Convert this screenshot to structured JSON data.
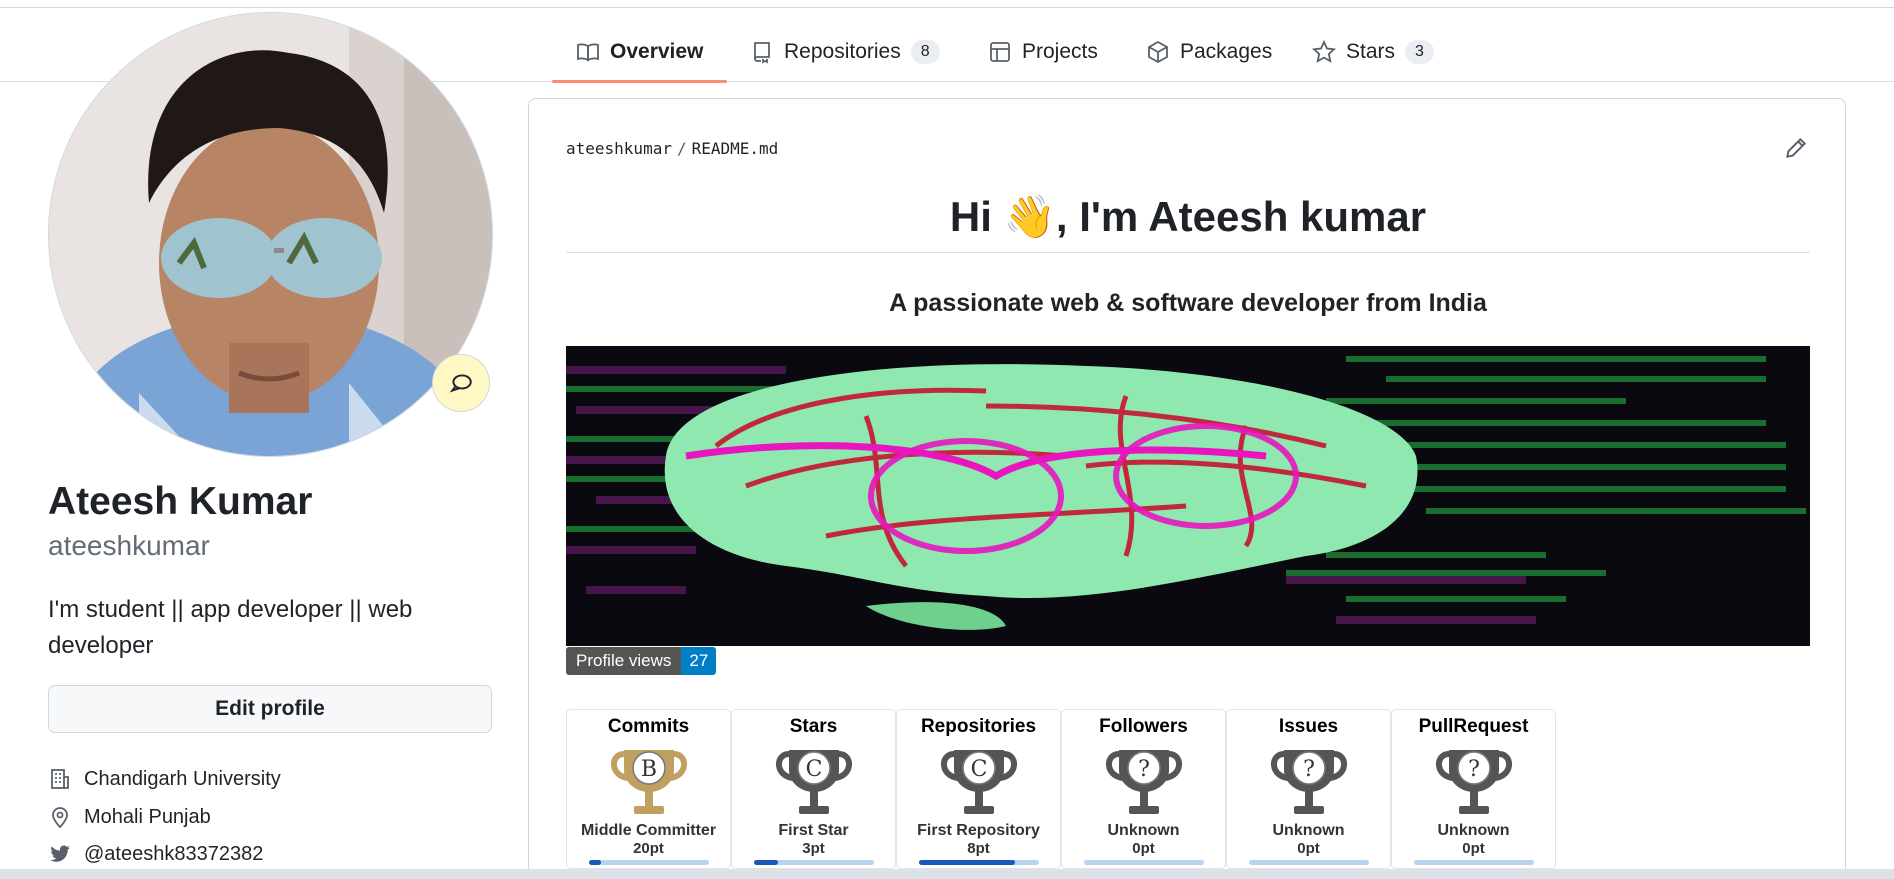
{
  "tabs": [
    {
      "label": "Overview",
      "icon": "book-icon",
      "active": true
    },
    {
      "label": "Repositories",
      "icon": "repo-icon",
      "count": "8"
    },
    {
      "label": "Projects",
      "icon": "table-icon"
    },
    {
      "label": "Packages",
      "icon": "package-icon"
    },
    {
      "label": "Stars",
      "icon": "star-icon",
      "count": "3"
    }
  ],
  "profile": {
    "fullname": "Ateesh Kumar",
    "username": "ateeshkumar",
    "bio": "I'm student || app developer || web developer",
    "edit_label": "Edit profile",
    "organization": "Chandigarh University",
    "location": "Mohali Punjab",
    "twitter": "@ateeshk83372382"
  },
  "readme": {
    "owner": "ateeshkumar",
    "file": "README.md",
    "title": "Hi 👋, I'm Ateesh kumar",
    "subtitle": "A passionate web & software developer from India",
    "badge_label": "Profile views",
    "badge_value": "27"
  },
  "trophies": [
    {
      "title": "Commits",
      "rank_letter": "B",
      "rank": "Middle Committer",
      "points": "20pt",
      "progress": 0.1,
      "color": "#c0a060"
    },
    {
      "title": "Stars",
      "rank_letter": "C",
      "rank": "First Star",
      "points": "3pt",
      "progress": 0.2,
      "color": "#555555"
    },
    {
      "title": "Repositories",
      "rank_letter": "C",
      "rank": "First Repository",
      "points": "8pt",
      "progress": 0.8,
      "color": "#555555"
    },
    {
      "title": "Followers",
      "rank_letter": "?",
      "rank": "Unknown",
      "points": "0pt",
      "progress": 0,
      "color": "#555555"
    },
    {
      "title": "Issues",
      "rank_letter": "?",
      "rank": "Unknown",
      "points": "0pt",
      "progress": 0,
      "color": "#555555"
    },
    {
      "title": "PullRequest",
      "rank_letter": "?",
      "rank": "Unknown",
      "points": "0pt",
      "progress": 0,
      "color": "#555555"
    }
  ],
  "colors": {
    "tab_underline": "#fd8c73",
    "badge_value_bg": "#007ec6",
    "status_bg": "#fff8c5"
  }
}
